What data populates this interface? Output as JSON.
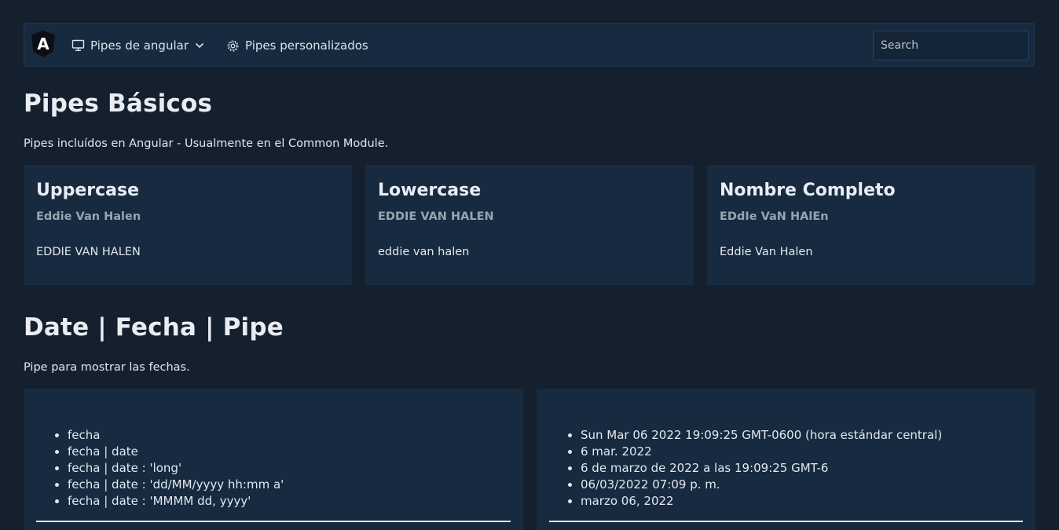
{
  "navbar": {
    "logo_letter": "A",
    "menu_pipes": "Pipes de angular",
    "menu_custom": "Pipes personalizados",
    "search_placeholder": "Search"
  },
  "section_basic": {
    "title": "Pipes Básicos",
    "description": "Pipes incluídos en Angular - Usualmente en el Common Module."
  },
  "cards": [
    {
      "title": "Uppercase",
      "subtitle": "Eddie Van Halen",
      "result": "EDDIE VAN HALEN"
    },
    {
      "title": "Lowercase",
      "subtitle": "EDDIE VAN HALEN",
      "result": "eddie van halen"
    },
    {
      "title": "Nombre Completo",
      "subtitle": "EDdIe VaN HAlEn",
      "result": "Eddie Van Halen"
    }
  ],
  "section_date": {
    "title": "Date | Fecha | Pipe",
    "description": "Pipe para mostrar las fechas."
  },
  "date_expressions": [
    "fecha",
    "fecha | date",
    "fecha | date : 'long'",
    "fecha | date : 'dd/MM/yyyy hh:mm a'",
    "fecha | date : 'MMMM dd, yyyy'"
  ],
  "date_results": [
    "Sun Mar 06 2022 19:09:25 GMT-0600 (hora estándar central)",
    "6 mar. 2022",
    "6 de marzo de 2022 a las 19:09:25 GMT-6",
    "06/03/2022 07:09 p. m.",
    "marzo 06, 2022"
  ]
}
